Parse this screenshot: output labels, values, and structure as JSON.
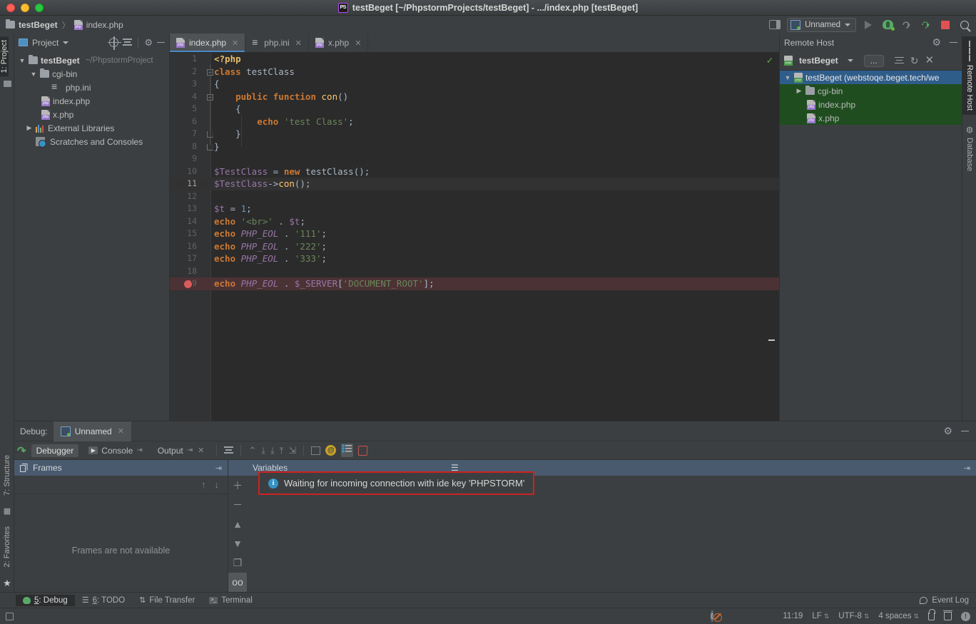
{
  "window": {
    "title": "testBeget [~/PhpstormProjects/testBeget] - .../index.php [testBeget]",
    "app_badge": "PS"
  },
  "breadcrumb": {
    "project": "testBeget",
    "separator": "〉",
    "file": "index.php"
  },
  "toolbar": {
    "run_config_label": "Unnamed",
    "icons": [
      "layout-icon",
      "run-icon",
      "debug-icon",
      "rerun-debug-icon",
      "coverage-icon",
      "stop-icon",
      "search-icon"
    ]
  },
  "left_strip": {
    "project_tab": "1: Project",
    "structure_tab": "7: Structure",
    "favorites_tab": "2: Favorites"
  },
  "right_strip": {
    "remote_host_tab": "Remote Host",
    "database_tab": "Database"
  },
  "project_panel": {
    "title": "Project",
    "tree": [
      {
        "label": "testBeget",
        "path": "~/PhpstormProject",
        "icon": "folder-icon",
        "indent": 0,
        "twisty": "▼",
        "bold": true
      },
      {
        "label": "cgi-bin",
        "path": "",
        "icon": "folder-icon",
        "indent": 1,
        "twisty": "▼",
        "bold": false
      },
      {
        "label": "php.ini",
        "path": "",
        "icon": "ini-file-icon",
        "indent": 2,
        "twisty": "",
        "bold": false
      },
      {
        "label": "index.php",
        "path": "",
        "icon": "php-file-icon",
        "indent": 1.4,
        "twisty": "",
        "bold": false
      },
      {
        "label": "x.php",
        "path": "",
        "icon": "php-file-icon",
        "indent": 1.4,
        "twisty": "",
        "bold": false
      },
      {
        "label": "External Libraries",
        "path": "",
        "icon": "libraries-icon",
        "indent": 0.6,
        "twisty": "▶",
        "bold": false
      },
      {
        "label": "Scratches and Consoles",
        "path": "",
        "icon": "scratches-icon",
        "indent": 1,
        "twisty": "",
        "bold": false
      }
    ]
  },
  "editor": {
    "tabs": [
      {
        "label": "index.php",
        "icon": "php-file-icon",
        "active": true
      },
      {
        "label": "php.ini",
        "icon": "ini-file-icon",
        "active": false
      },
      {
        "label": "x.php",
        "icon": "php-file-icon",
        "active": false
      }
    ],
    "inspection_status": "✓",
    "current_line": 11,
    "breakpoint_line": 19,
    "lines": [
      {
        "n": 1,
        "tokens": [
          {
            "t": "<?php",
            "c": "t-tag"
          }
        ]
      },
      {
        "n": 2,
        "tokens": [
          {
            "t": "class ",
            "c": "t-kw"
          },
          {
            "t": "testClass",
            "c": "t-cls"
          }
        ],
        "fold": true
      },
      {
        "n": 3,
        "tokens": [
          {
            "t": "{",
            "c": "t-brace"
          }
        ]
      },
      {
        "n": 4,
        "tokens": [
          {
            "t": "    public function ",
            "c": "t-kw"
          },
          {
            "t": "con",
            "c": "t-fn"
          },
          {
            "t": "()",
            "c": "t-plain"
          }
        ],
        "fold": true
      },
      {
        "n": 5,
        "tokens": [
          {
            "t": "    {",
            "c": "t-brace"
          }
        ]
      },
      {
        "n": 6,
        "tokens": [
          {
            "t": "        echo ",
            "c": "t-kw"
          },
          {
            "t": "'test Class'",
            "c": "t-str"
          },
          {
            "t": ";",
            "c": "t-plain"
          }
        ]
      },
      {
        "n": 7,
        "tokens": [
          {
            "t": "    }",
            "c": "t-brace"
          }
        ],
        "foldend": true
      },
      {
        "n": 8,
        "tokens": [
          {
            "t": "}",
            "c": "t-brace"
          }
        ],
        "foldend": true
      },
      {
        "n": 9,
        "tokens": []
      },
      {
        "n": 10,
        "tokens": [
          {
            "t": "$TestClass",
            "c": "t-var"
          },
          {
            "t": " = ",
            "c": "t-plain"
          },
          {
            "t": "new ",
            "c": "t-kw"
          },
          {
            "t": "testClass",
            "c": "t-cls"
          },
          {
            "t": "();",
            "c": "t-plain"
          }
        ]
      },
      {
        "n": 11,
        "tokens": [
          {
            "t": "$TestClass",
            "c": "t-var"
          },
          {
            "t": "->",
            "c": "t-plain"
          },
          {
            "t": "con",
            "c": "t-fn"
          },
          {
            "t": "();",
            "c": "t-plain"
          }
        ]
      },
      {
        "n": 12,
        "tokens": []
      },
      {
        "n": 13,
        "tokens": [
          {
            "t": "$t",
            "c": "t-var"
          },
          {
            "t": " = ",
            "c": "t-plain"
          },
          {
            "t": "1",
            "c": "t-num"
          },
          {
            "t": ";",
            "c": "t-plain"
          }
        ]
      },
      {
        "n": 14,
        "tokens": [
          {
            "t": "echo ",
            "c": "t-kw"
          },
          {
            "t": "'<br>'",
            "c": "t-str"
          },
          {
            "t": " . ",
            "c": "t-plain"
          },
          {
            "t": "$t",
            "c": "t-var"
          },
          {
            "t": ";",
            "c": "t-plain"
          }
        ]
      },
      {
        "n": 15,
        "tokens": [
          {
            "t": "echo ",
            "c": "t-kw"
          },
          {
            "t": "PHP_EOL",
            "c": "t-const"
          },
          {
            "t": " . ",
            "c": "t-plain"
          },
          {
            "t": "'111'",
            "c": "t-str"
          },
          {
            "t": ";",
            "c": "t-plain"
          }
        ]
      },
      {
        "n": 16,
        "tokens": [
          {
            "t": "echo ",
            "c": "t-kw"
          },
          {
            "t": "PHP_EOL",
            "c": "t-const"
          },
          {
            "t": " . ",
            "c": "t-plain"
          },
          {
            "t": "'222'",
            "c": "t-str"
          },
          {
            "t": ";",
            "c": "t-plain"
          }
        ]
      },
      {
        "n": 17,
        "tokens": [
          {
            "t": "echo ",
            "c": "t-kw"
          },
          {
            "t": "PHP_EOL",
            "c": "t-const"
          },
          {
            "t": " . ",
            "c": "t-plain"
          },
          {
            "t": "'333'",
            "c": "t-str"
          },
          {
            "t": ";",
            "c": "t-plain"
          }
        ]
      },
      {
        "n": 18,
        "tokens": []
      },
      {
        "n": 19,
        "tokens": [
          {
            "t": "echo ",
            "c": "t-kw"
          },
          {
            "t": "PHP_EOL",
            "c": "t-const"
          },
          {
            "t": " . ",
            "c": "t-plain"
          },
          {
            "t": "$_SERVER",
            "c": "t-var"
          },
          {
            "t": "[",
            "c": "t-plain"
          },
          {
            "t": "'DOCUMENT_ROOT'",
            "c": "t-str"
          },
          {
            "t": "];",
            "c": "t-plain"
          }
        ]
      }
    ]
  },
  "remote_panel": {
    "title": "Remote Host",
    "server_name": "testBeget",
    "more_button": "...",
    "tree": [
      {
        "label": "testBeget (webstoqe.beget.tech/we",
        "icon": "ftp-icon",
        "indent": 0,
        "twisty": "▼",
        "state": "selected-root"
      },
      {
        "label": "cgi-bin",
        "icon": "folder-icon",
        "indent": 1,
        "twisty": "▶",
        "state": "sel-green"
      },
      {
        "label": "index.php",
        "icon": "php-file-icon",
        "indent": 1.4,
        "twisty": "",
        "state": "sel-green"
      },
      {
        "label": "x.php",
        "icon": "php-file-icon",
        "indent": 1.4,
        "twisty": "",
        "state": "sel-green"
      }
    ]
  },
  "debug": {
    "label": "Debug:",
    "session_tab": "Unnamed",
    "tool_tabs": [
      {
        "label": "Debugger",
        "active": true
      },
      {
        "label": "Console",
        "active": false
      },
      {
        "label": "Output",
        "active": false
      }
    ],
    "frames_title": "Frames",
    "frames_empty": "Frames are not available",
    "variables_title": "Variables",
    "waiting_message": "Waiting for incoming connection with ide key 'PHPSTORM'",
    "highlight_color": "#cc2222"
  },
  "bottom_tabs": [
    {
      "num": "5",
      "label": ": Debug",
      "icon": "debug-bug-icon",
      "active": true
    },
    {
      "num": "6",
      "label": ": TODO",
      "icon": "todo-icon",
      "active": false
    },
    {
      "num": "",
      "label": "File Transfer",
      "icon": "file-transfer-icon",
      "active": false
    },
    {
      "num": "",
      "label": "Terminal",
      "icon": "terminal-icon",
      "active": false
    }
  ],
  "event_log": "Event Log",
  "statusbar": {
    "time": "11:19",
    "line_ending": "LF",
    "encoding": "UTF-8",
    "indent": "4 spaces"
  }
}
